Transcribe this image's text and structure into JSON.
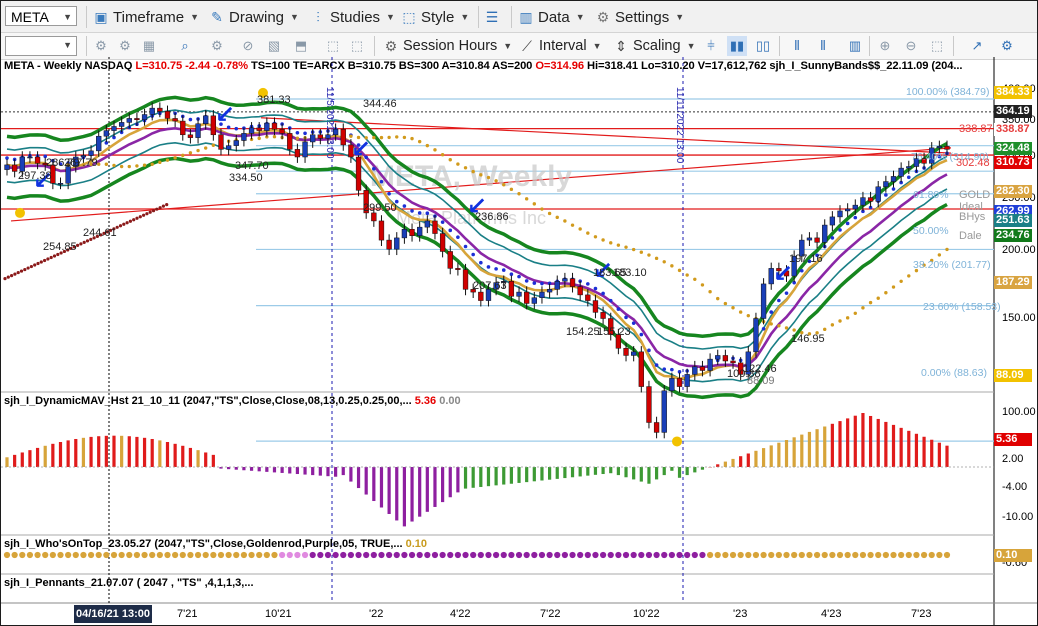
{
  "toolbar": {
    "symbol": "META",
    "timeframe": "Timeframe",
    "drawing": "Drawing",
    "studies": "Studies",
    "style": "Style",
    "data": "Data",
    "settings": "Settings",
    "session_hours": "Session Hours",
    "interval": "Interval",
    "scaling": "Scaling"
  },
  "header": {
    "symbol_line": "META - Weekly  NASDAQ",
    "change_line": "L=310.75  -2.44  -0.78%",
    "stats_line": "TS=100  TE=ARCX  B=310.75  BS=300  A=310.84  AS=200",
    "open_line": "O=314.96",
    "range_line": "Hi=318.41  Lo=310.20  V=17,612,762  sjh_I_SunnyBands$$_22.11.09 (204..."
  },
  "colors": {
    "up_bar": "#0b3aa8",
    "down_bar": "#e00000",
    "band_outer": "#16861f",
    "band_inner": "#1a7f86",
    "purple_line": "#8a26a6",
    "gold_line": "#d7a43a",
    "dots_blue": "#1c2fd6",
    "dots_gold": "#d19a1c",
    "dots_darkred": "#8b1a1a",
    "fib": "#9ccbe8",
    "red_line": "#e21b1b"
  },
  "price_axis": {
    "labels": [
      "400.00",
      "350.00",
      "300.00",
      "250.00",
      "200.00",
      "150.00",
      "100.00"
    ],
    "tags": [
      {
        "text": "384.33",
        "bg": "#f2c200",
        "fg": "#ffffff"
      },
      {
        "text": "364.19",
        "bg": "#202020",
        "fg": "#ffffff"
      },
      {
        "text": "338.87",
        "bg": "#ffffff",
        "fg": "#e63b3b"
      },
      {
        "text": "324.48",
        "bg": "#1e8f2a",
        "fg": "#ffffff"
      },
      {
        "text": "310.73",
        "bg": "#e00000",
        "fg": "#ffffff"
      },
      {
        "text": "282.30",
        "bg": "#d9a441",
        "fg": "#ffffff"
      },
      {
        "text": "262.99",
        "bg": "#1f3fd8",
        "fg": "#ffffff"
      },
      {
        "text": "251.63",
        "bg": "#1a7f86",
        "fg": "#ffffff"
      },
      {
        "text": "234.76",
        "bg": "#127a1b",
        "fg": "#ffffff"
      },
      {
        "text": "187.29",
        "bg": "#d9a441",
        "fg": "#ffffff"
      },
      {
        "text": "88.09",
        "bg": "#f2c200",
        "fg": "#ffffff"
      }
    ]
  },
  "fib_labels": [
    "100.00% (384.79)",
    "76.40% (314.90)",
    "61.80%",
    "50.00%",
    "38.20% (201.77)",
    "23.60% (158.53)",
    "0.00% (88.63)"
  ],
  "chart_annotations": [
    "297.38",
    "286.79",
    "267.79",
    "254.85",
    "244.61",
    "347.70",
    "334.50",
    "381.33",
    "344.46",
    "299.50",
    "236.86",
    "207.63",
    "183.65",
    "183.10",
    "154.25",
    "155.23",
    "197.16",
    "146.95",
    "122.46",
    "100.38",
    "88.09",
    "338.87",
    "302.48",
    "GOLD",
    "Ideal",
    "BHys",
    "Dale"
  ],
  "date_stamps": [
    "11/5/2021 13:00",
    "11/11/2022 13:00"
  ],
  "watermark": {
    "title": "META, Weekly",
    "sub": "Meta Platforms Inc"
  },
  "x_axis": {
    "cursor_label": "04/16/21 13:00",
    "labels": [
      "7'21",
      "10'21",
      "'22",
      "4'22",
      "7'22",
      "10'22",
      "'23",
      "4'23",
      "7'23"
    ]
  },
  "indicators": {
    "dyn_mav": {
      "name": "sjh_I_DynamicMAV_Hst 21_10_11 (2047,\"TS\",Close,Close,08,13,0.25,0.25,00,...",
      "value1": "5.36",
      "value2": "0.00",
      "axis": [
        "2.00",
        "-4.00",
        "-10.00"
      ],
      "tag": "5.36"
    },
    "whos_on_top": {
      "name": "sjh_I_Who'sOnTop_23.05.27 (2047,\"TS\",Close,Goldenrod,Purple,05,  TRUE,...",
      "value": "0.10",
      "axis": [
        "0.10",
        "-0.60"
      ]
    },
    "pennants": {
      "name": "sjh_I_Pennants_21.07.07 ( 2047 , \"TS\" ,4,1,1,3,..."
    }
  },
  "chart_data": {
    "type": "line",
    "title": "META - Weekly  NASDAQ",
    "xlabel": "",
    "ylabel": "",
    "x": [
      "7'21",
      "10'21",
      "'22",
      "4'22",
      "7'22",
      "10'22",
      "'23",
      "4'23",
      "7'23"
    ],
    "series": [],
    "ylim": [
      75,
      400
    ],
    "scale": "log",
    "grid": false,
    "weekly_close_estimate": [
      290,
      282,
      300,
      300,
      292,
      290,
      268,
      268,
      288,
      300,
      302,
      308,
      328,
      336,
      342,
      348,
      354,
      352,
      360,
      370,
      365,
      354,
      350,
      330,
      326,
      346,
      358,
      330,
      310,
      315,
      322,
      332,
      340,
      336,
      347,
      338,
      332,
      310,
      300,
      320,
      330,
      325,
      330,
      338,
      316,
      300,
      260,
      236,
      228,
      210,
      202,
      212,
      220,
      214,
      222,
      228,
      216,
      200,
      186,
      185,
      170,
      168,
      162,
      170,
      175,
      176,
      165,
      168,
      160,
      164,
      168,
      170,
      176,
      178,
      172,
      166,
      162,
      154,
      150,
      140,
      132,
      128,
      130,
      112,
      96,
      92,
      110,
      116,
      112,
      118,
      122,
      120,
      126,
      128,
      125,
      124,
      118,
      130,
      150,
      174,
      186,
      184,
      180,
      196,
      210,
      212,
      208,
      224,
      232,
      238,
      240,
      244,
      252,
      248,
      264,
      270,
      276,
      286,
      288,
      298,
      292,
      312,
      314,
      310
    ]
  }
}
